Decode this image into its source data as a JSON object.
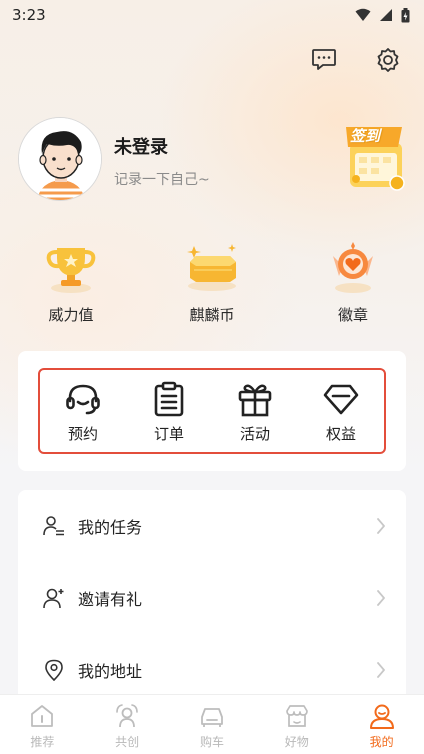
{
  "status_bar": {
    "time": "3:23"
  },
  "profile": {
    "nickname": "未登录",
    "signature": "记录一下自己~",
    "checkin_label": "签到"
  },
  "assets": [
    {
      "label": "威力值",
      "icon": "trophy-icon"
    },
    {
      "label": "麒麟币",
      "icon": "gold-bar-icon"
    },
    {
      "label": "徽章",
      "icon": "badge-icon"
    }
  ],
  "services": [
    {
      "label": "预约",
      "icon": "headset-icon"
    },
    {
      "label": "订单",
      "icon": "clipboard-icon"
    },
    {
      "label": "活动",
      "icon": "gift-icon"
    },
    {
      "label": "权益",
      "icon": "diamond-icon"
    }
  ],
  "menu": [
    {
      "label": "我的任务",
      "icon": "task-user-icon"
    },
    {
      "label": "邀请有礼",
      "icon": "invite-user-icon"
    },
    {
      "label": "我的地址",
      "icon": "location-pin-icon"
    }
  ],
  "tabs": [
    {
      "label": "推荐",
      "icon": "home-icon",
      "active": false
    },
    {
      "label": "共创",
      "icon": "community-icon",
      "active": false
    },
    {
      "label": "购车",
      "icon": "car-icon",
      "active": false
    },
    {
      "label": "好物",
      "icon": "shop-icon",
      "active": false
    },
    {
      "label": "我的",
      "icon": "profile-icon",
      "active": true
    }
  ],
  "colors": {
    "accent": "#f26a1b",
    "highlight_frame": "#e34d3b",
    "tab_inactive": "#b9b9b9"
  }
}
